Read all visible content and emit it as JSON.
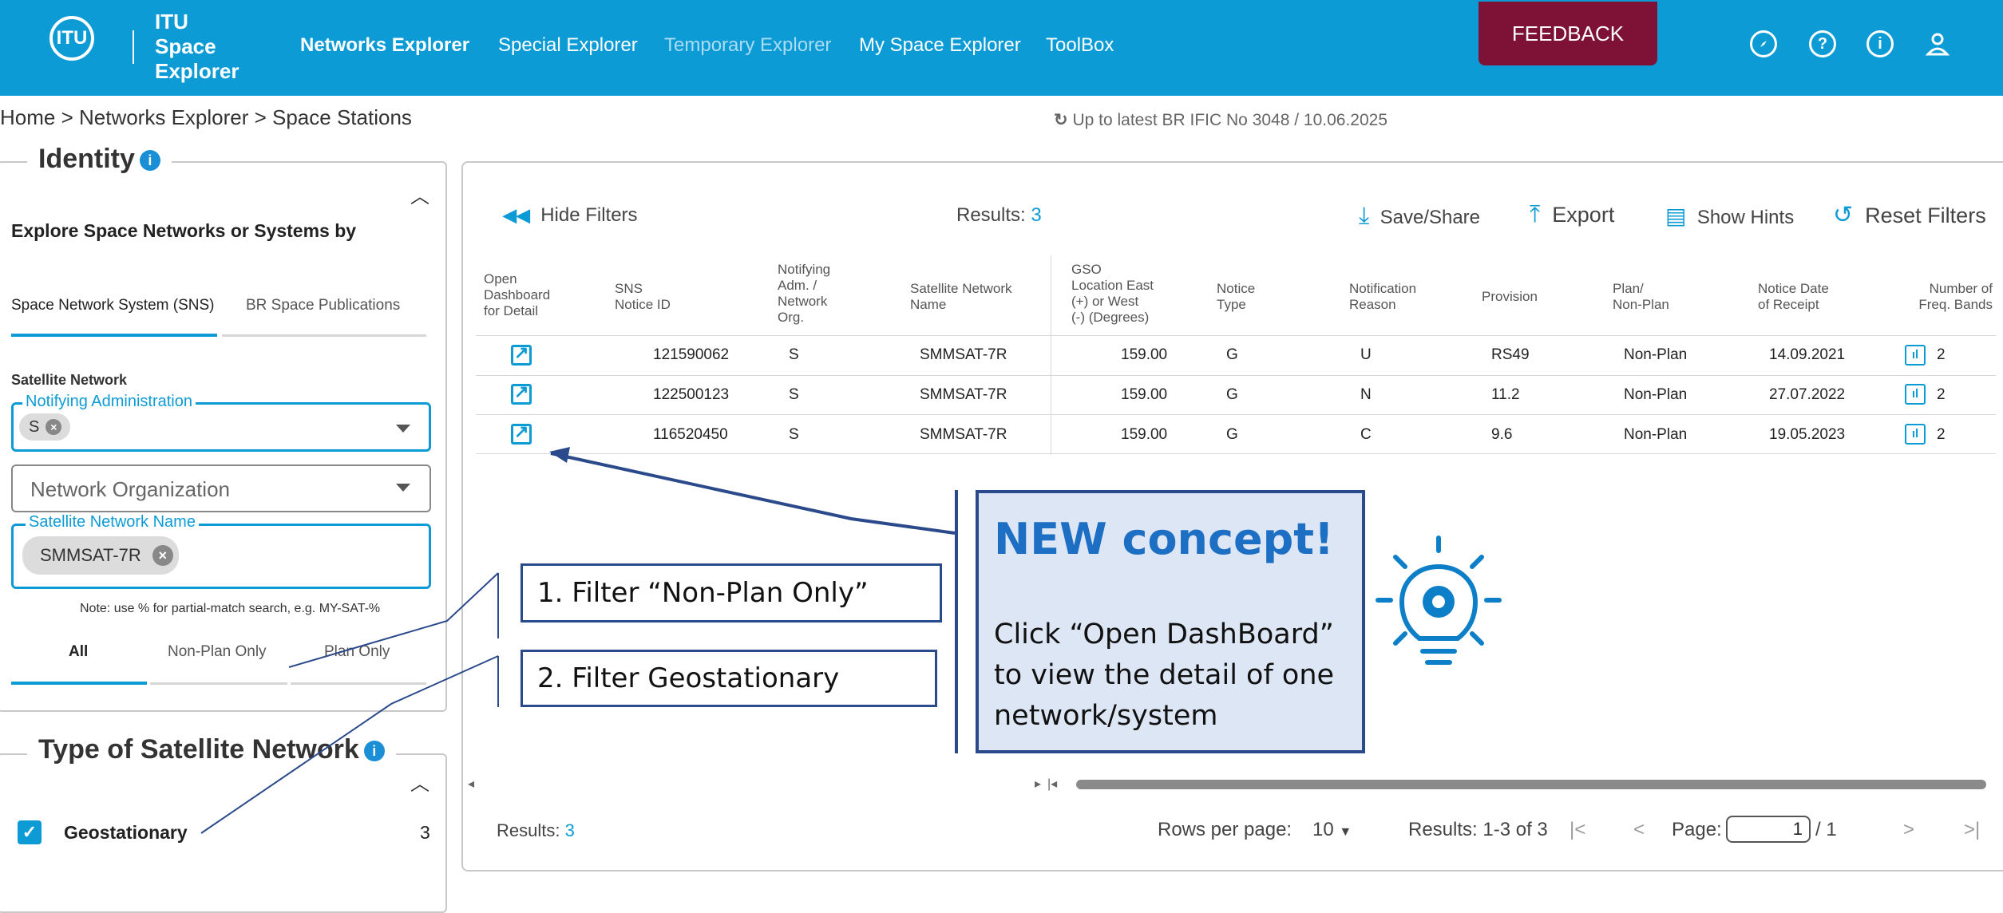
{
  "header": {
    "logo_mark": "ITU",
    "logo_line1": "ITU",
    "logo_line2": "Space",
    "logo_line3": "Explorer",
    "nav": [
      "Networks Explorer",
      "Special Explorer",
      "Temporary Explorer",
      "My Space Explorer",
      "ToolBox"
    ],
    "feedback": "FEEDBACK",
    "icons": [
      "compass-icon",
      "help-icon",
      "info-icon",
      "user-icon"
    ],
    "help_glyph": "?",
    "info_glyph": "i",
    "accent_color": "#0d9bd6",
    "feedback_color": "#7d1236"
  },
  "breadcrumb": "Home > Networks Explorer > Space Stations",
  "update_note": "Up to latest BR IFIC No 3048 / 10.06.2025",
  "identity": {
    "title": "Identity",
    "explore_label": "Explore Space Networks or Systems by",
    "tabs": [
      "Space Network System (SNS)",
      "BR Space Publications"
    ],
    "satellite_network_label": "Satellite Network",
    "notifying_admin_label": "Notifying Administration",
    "notifying_admin_value": "S",
    "network_org_placeholder": "Network Organization",
    "sat_name_label": "Satellite Network Name",
    "sat_name_value": "SMMSAT-7R",
    "note": "Note: use % for partial-match search, e.g. MY-SAT-%",
    "plan_tabs": [
      "All",
      "Non-Plan Only",
      "Plan Only"
    ]
  },
  "type_section": {
    "title": "Type of Satellite Network",
    "item_label": "Geostationary",
    "item_count": "3"
  },
  "toolbar": {
    "hide_filters": "Hide Filters",
    "results_label": "Results:",
    "results_count": "3",
    "save_share": "Save/Share",
    "export": "Export",
    "show_hints": "Show Hints",
    "reset_filters": "Reset Filters"
  },
  "table": {
    "headers": [
      "Open Dashboard for Detail",
      "SNS Notice ID",
      "Notifying Adm. / Network Org.",
      "Satellite Network Name",
      "GSO Location East (+) or West (-) (Degrees)",
      "Notice Type",
      "Notification Reason",
      "Provision",
      "Plan/ Non-Plan",
      "Notice Date of Receipt",
      "Number of Freq. Bands"
    ],
    "rows": [
      [
        "121590062",
        "S",
        "SMMSAT-7R",
        "159.00",
        "G",
        "U",
        "RS49",
        "Non-Plan",
        "14.09.2021",
        "2"
      ],
      [
        "122500123",
        "S",
        "SMMSAT-7R",
        "159.00",
        "G",
        "N",
        "11.2",
        "Non-Plan",
        "27.07.2022",
        "2"
      ],
      [
        "116520450",
        "S",
        "SMMSAT-7R",
        "159.00",
        "G",
        "C",
        "9.6",
        "Non-Plan",
        "19.05.2023",
        "2"
      ]
    ]
  },
  "footer": {
    "results_label": "Results:",
    "results_count": "3",
    "rows_per_page_label": "Rows per page:",
    "rows_per_page_value": "10",
    "range": "Results: 1-3 of 3",
    "page_label": "Page:",
    "page_value": "1",
    "page_total": "/ 1",
    "first_glyph": "|<",
    "prev_glyph": "<",
    "next_glyph": ">",
    "last_glyph": ">|"
  },
  "annotations": {
    "step1": "1.   Filter “Non-Plan Only”",
    "step2": "2. Filter Geostationary",
    "concept_title": "NEW concept!",
    "concept_body": "Click “Open DashBoard” to view the detail of one network/system",
    "box_color": "#dde6f4",
    "line_color": "#2b4a8b"
  }
}
